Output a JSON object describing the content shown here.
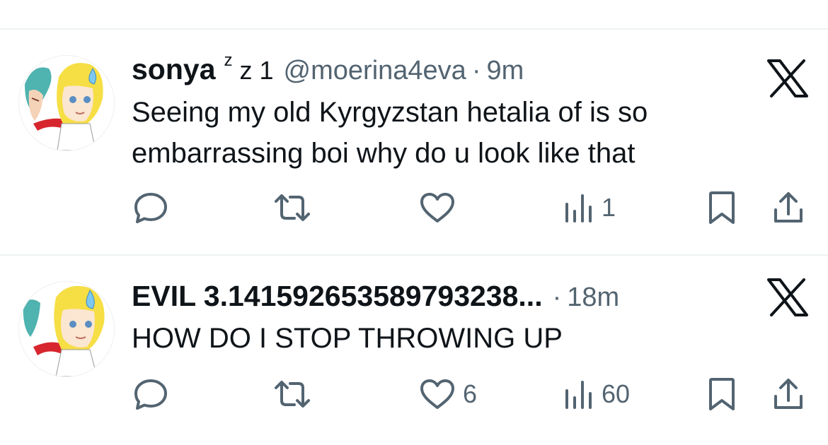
{
  "tweets": [
    {
      "author": {
        "display_name": "sonya",
        "name_suffix_sup": "z",
        "name_suffix": "z 1",
        "handle": "@moerina4eva"
      },
      "separator": "·",
      "time": "9m",
      "text_lines": [
        "Seeing my old Kyrgyzstan hetalia of is so",
        "embarrassing boi why do u look like that"
      ],
      "metrics": {
        "replies": "",
        "reposts": "",
        "likes": "",
        "views": "1"
      }
    },
    {
      "author": {
        "display_name": "EVIL 3.14159265358979323​8...",
        "handle": ""
      },
      "separator": "·",
      "time": "18m",
      "text_lines": [
        "HOW DO I STOP THROWING UP"
      ],
      "metrics": {
        "replies": "",
        "reposts": "",
        "likes": "6",
        "views": "60"
      }
    }
  ],
  "icons": {
    "close": "x-logo-icon",
    "reply": "reply-icon",
    "repost": "repost-icon",
    "like": "heart-icon",
    "views": "views-chart-icon",
    "bookmark": "bookmark-icon",
    "share": "share-icon"
  },
  "colors": {
    "text_primary": "#0f1419",
    "text_secondary": "#536471",
    "divider": "#eff3f4"
  }
}
